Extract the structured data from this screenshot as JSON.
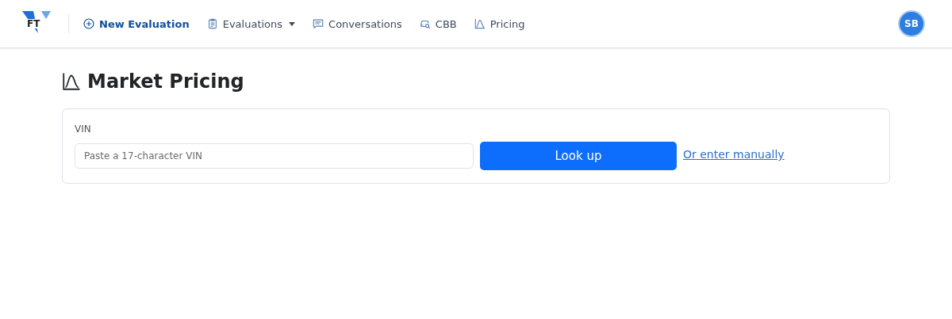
{
  "navbar": {
    "logo": {
      "text": "FT"
    },
    "items": [
      {
        "label": "New Evaluation",
        "kind": "primary",
        "dropdown": false
      },
      {
        "label": "Evaluations",
        "kind": "link",
        "dropdown": true
      },
      {
        "label": "Conversations",
        "kind": "link",
        "dropdown": false
      },
      {
        "label": "CBB",
        "kind": "link",
        "dropdown": false
      },
      {
        "label": "Pricing",
        "kind": "link",
        "dropdown": false
      }
    ],
    "avatar": {
      "initials": "SB"
    }
  },
  "page": {
    "title": "Market Pricing",
    "form": {
      "label": "VIN",
      "placeholder": "Paste a 17-character VIN",
      "button": "Look up",
      "link": "Or enter manually"
    }
  }
}
